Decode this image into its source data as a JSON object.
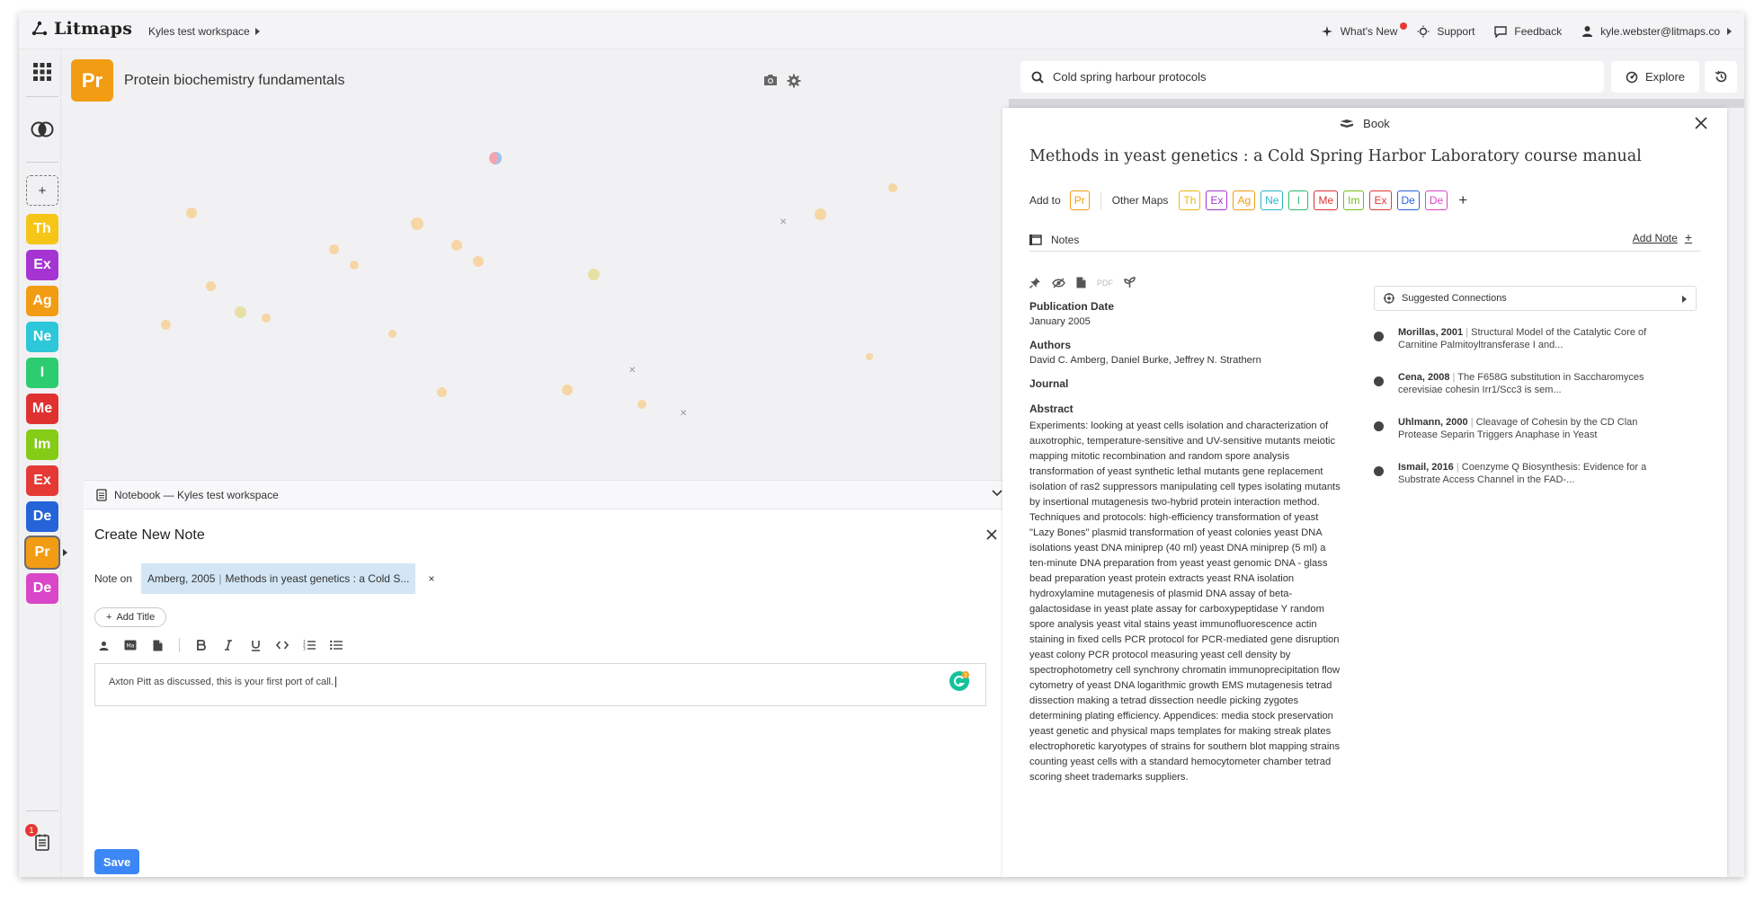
{
  "app": {
    "name": "Litmaps",
    "workspace": "Kyles test workspace"
  },
  "topnav": {
    "whats_new": "What's New",
    "support": "Support",
    "feedback": "Feedback",
    "user": "kyle.webster@litmaps.co"
  },
  "rail": {
    "add_label": "+",
    "maps": [
      {
        "abbr": "Th",
        "color": "#f5c518"
      },
      {
        "abbr": "Ex",
        "color": "#a534d3"
      },
      {
        "abbr": "Ag",
        "color": "#f29c13"
      },
      {
        "abbr": "Ne",
        "color": "#2cc7d8"
      },
      {
        "abbr": "I",
        "color": "#2ecc71"
      },
      {
        "abbr": "Me",
        "color": "#e03131"
      },
      {
        "abbr": "Im",
        "color": "#84cc16"
      },
      {
        "abbr": "Ex",
        "color": "#e53935"
      },
      {
        "abbr": "De",
        "color": "#2563d8"
      },
      {
        "abbr": "Pr",
        "color": "#f29c13"
      },
      {
        "abbr": "De",
        "color": "#d946c8"
      }
    ],
    "notebook_badge": "1"
  },
  "map": {
    "badge": "Pr",
    "title": "Protein biochemistry fundamentals"
  },
  "notebook": {
    "header": "Notebook — Kyles test workspace",
    "create_title": "Create New Note",
    "note_on_label": "Note on",
    "chip_author": "Amberg, 2005",
    "chip_title": "Methods in yeast genetics : a Cold S...",
    "chip_remove": "×",
    "add_title": "Add Title",
    "editor_text": "Axton Pitt as discussed, this is your first port of call.",
    "grammarly_count": "1",
    "save": "Save"
  },
  "search": {
    "value": "Cold spring harbour protocols",
    "explore": "Explore"
  },
  "panel": {
    "type": "Book",
    "title": "Methods in yeast genetics : a Cold Spring Harbor Laboratory course manual",
    "add_to": "Add to",
    "add_to_tag": "Pr",
    "other_maps": "Other Maps",
    "other_tags": [
      {
        "abbr": "Th",
        "color": "#e8b810"
      },
      {
        "abbr": "Ex",
        "color": "#a534d3"
      },
      {
        "abbr": "Ag",
        "color": "#f29c13"
      },
      {
        "abbr": "Ne",
        "color": "#2cb7c8"
      },
      {
        "abbr": "I",
        "color": "#2eb872"
      },
      {
        "abbr": "Me",
        "color": "#e03131"
      },
      {
        "abbr": "Im",
        "color": "#74bc16"
      },
      {
        "abbr": "Ex",
        "color": "#e53935"
      },
      {
        "abbr": "De",
        "color": "#2563d8"
      },
      {
        "abbr": "De",
        "color": "#d946c8"
      }
    ],
    "plus": "+",
    "notes_label": "Notes",
    "add_note": "Add Note",
    "pdf_label": "PDF",
    "pub_date_label": "Publication Date",
    "pub_date": "January 2005",
    "authors_label": "Authors",
    "authors": "David C. Amberg, Daniel Burke, Jeffrey N. Strathern",
    "journal_label": "Journal",
    "abstract_label": "Abstract",
    "abstract": "Experiments: looking at yeast cells isolation and characterization of auxotrophic, temperature-sensitive and UV-sensitive mutants meiotic mapping mitotic recombination and random spore analysis transformation of yeast synthetic lethal mutants gene replacement isolation of ras2 suppressors manipulating cell types isolating mutants by insertional mutagenesis two-hybrid protein interaction method. Techniques and protocols: high-efficiency transformation of yeast \"Lazy Bones\" plasmid transformation of yeast colonies yeast DNA isolations yeast DNA miniprep (40 ml) yeast DNA miniprep (5 ml) a ten-minute DNA preparation from yeast yeast genomic DNA - glass bead preparation yeast protein extracts yeast RNA isolation hydroxylamine mutagenesis of plasmid DNA assay of beta-galactosidase in yeast plate assay for carboxypeptidase Y random spore analysis yeast vital stains yeast immunofluorescence actin staining in fixed cells PCR protocol for PCR-mediated gene disruption yeast colony PCR protocol measuring yeast cell density by spectrophotometry cell synchrony chromatin immunoprecipitation flow cytometry of yeast DNA logarithmic growth EMS mutagenesis tetrad dissection making a tetrad dissection needle picking zygotes determining plating efficiency. Appendices: media stock preservation yeast genetic and physical maps templates for making streak plates electrophoretic karyotypes of strains for southern blot mapping strains counting yeast cells with a standard hemocytometer chamber tetrad scoring sheet trademarks suppliers.",
    "suggested_label": "Suggested Connections",
    "connections": [
      {
        "cite": "Morillas, 2001",
        "title": "Structural Model of the Catalytic Core of Carnitine Palmitoyltransferase I and..."
      },
      {
        "cite": "Cena, 2008",
        "title": "The F658G substitution in Saccharomyces cerevisiae cohesin Irr1/Scc3 is sem..."
      },
      {
        "cite": "Uhlmann, 2000",
        "title": "Cleavage of Cohesin by the CD Clan Protease Separin Triggers Anaphase in Yeast"
      },
      {
        "cite": "Ismail, 2016",
        "title": "Coenzyme Q Biosynthesis: Evidence for a Substrate Access Channel in the FAD-..."
      }
    ]
  }
}
